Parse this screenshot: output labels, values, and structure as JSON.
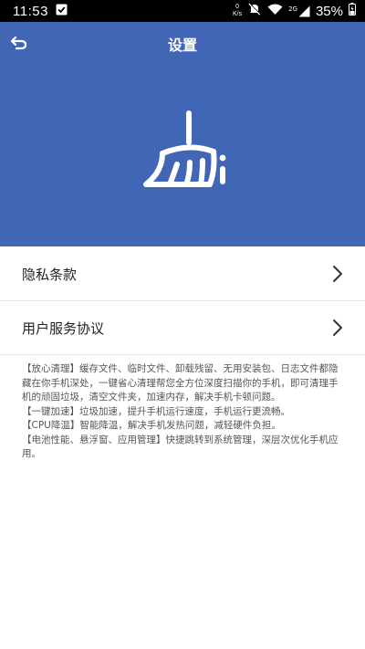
{
  "status_bar": {
    "time": "11:53",
    "net_speed_value": "0",
    "net_speed_unit": "K/s",
    "signal_label": "2G",
    "battery": "35%"
  },
  "header": {
    "title": "设置",
    "icon": "broom-icon",
    "background_color": "#4166b5"
  },
  "menu": {
    "items": [
      {
        "label": "隐私条款",
        "icon": "chevron-right-icon"
      },
      {
        "label": "用户服务协议",
        "icon": "chevron-right-icon"
      }
    ]
  },
  "description": {
    "paragraphs": [
      "【放心清理】缓存文件、临时文件、卸载残留、无用安装包、日志文件都隐藏在你手机深处，一键省心清理帮您全方位深度扫描你的手机，即可清理手机的顽固垃圾，清空文件夹，加速内存，解决手机卡顿问题。",
      "【一键加速】垃圾加速，提升手机运行速度，手机运行更流畅。",
      "【CPU降温】智能降温，解决手机发热问题，减轻硬件负担。",
      "【电池性能、悬浮窗、应用管理】快捷跳转到系统管理，深层次优化手机应用。"
    ]
  }
}
